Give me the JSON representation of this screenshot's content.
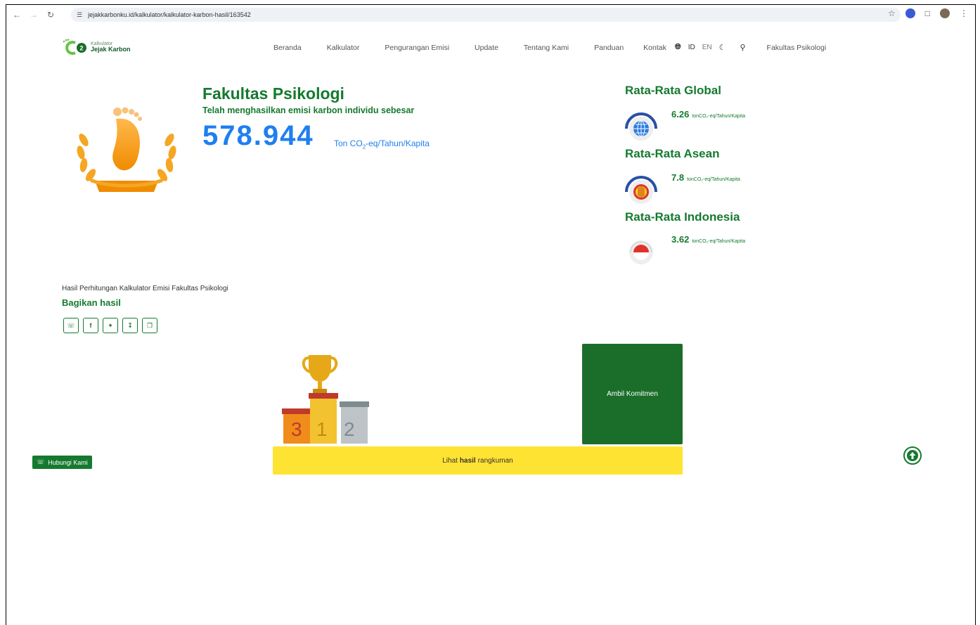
{
  "browser": {
    "url": "jejakkarbonku.id/kalkulator/kalkulator-karbon-hasil/163542"
  },
  "header": {
    "logo_line1": "Kalkulator",
    "logo_line2": "Jejak Karbon",
    "menu": [
      "Beranda",
      "Kalkulator",
      "Pengurangan Emisi",
      "Update",
      "Tentang Kami",
      "Panduan",
      "Kontak"
    ],
    "lang_id": "ID",
    "lang_en": "EN",
    "user": "Fakultas Psikologi"
  },
  "hero": {
    "title": "Fakultas Psikologi",
    "subtitle": "Telah menghasilkan emisi karbon individu sebesar",
    "value": "578.944",
    "unit_prefix": "Ton CO",
    "unit_sub": "2",
    "unit_suffix": "-eq/Tahun/Kapita"
  },
  "averages": [
    {
      "title": "Rata-Rata Global",
      "value": "6.26",
      "unit": "tonCO₂-eq/Tahun/Kapita",
      "icon": "globe-icon"
    },
    {
      "title": "Rata-Rata Asean",
      "value": "7.8",
      "unit": "tonCO₂-eq/Tahun/Kapita",
      "icon": "asean-icon"
    },
    {
      "title": "Rata-Rata Indonesia",
      "value": "3.62",
      "unit": "tonCO₂-eq/Tahun/Kapita",
      "icon": "indonesia-flag-icon"
    }
  ],
  "share": {
    "label": "Hasil Perhitungan Kalkulator Emisi Fakultas Psikologi",
    "title": "Bagikan hasil"
  },
  "podium": {
    "left": "3",
    "middle": "1",
    "right": "2"
  },
  "actions": {
    "commit": "Ambil Komitmen",
    "summary_pre": "Lihat",
    "summary_bold": "hasil",
    "summary_post": "rangkuman",
    "contact": "Hubungi Kami"
  },
  "colors": {
    "brand_green": "#157a2f",
    "accent_blue": "#1f7ff0",
    "summary_yellow": "#ffe333",
    "commit_green": "#1b6e2a"
  }
}
